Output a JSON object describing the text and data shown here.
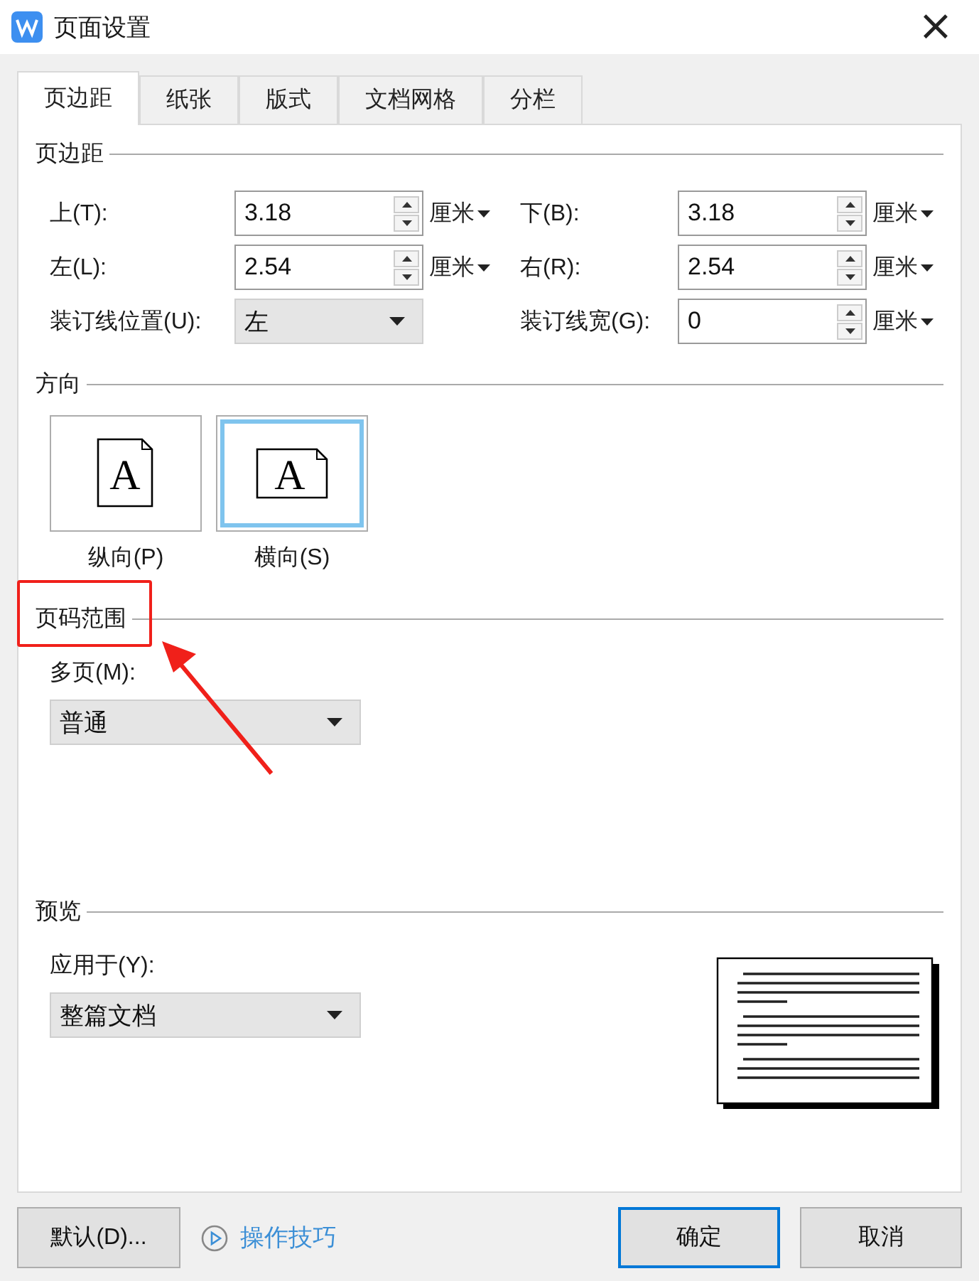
{
  "window": {
    "title": "页面设置",
    "close": "×"
  },
  "tabs": [
    {
      "label": "页边距",
      "selected": true
    },
    {
      "label": "纸张",
      "selected": false
    },
    {
      "label": "版式",
      "selected": false
    },
    {
      "label": "文档网格",
      "selected": false
    },
    {
      "label": "分栏",
      "selected": false
    }
  ],
  "margins": {
    "title": "页边距",
    "fields": [
      {
        "label": "上(T):",
        "kind": "spinner",
        "value": "3.18",
        "unit": "厘米"
      },
      {
        "label": "下(B):",
        "kind": "spinner",
        "value": "3.18",
        "unit": "厘米"
      },
      {
        "label": "左(L):",
        "kind": "spinner",
        "value": "2.54",
        "unit": "厘米"
      },
      {
        "label": "右(R):",
        "kind": "spinner",
        "value": "2.54",
        "unit": "厘米"
      },
      {
        "label": "装订线位置(U):",
        "kind": "select",
        "value": "左"
      },
      {
        "label": "装订线宽(G):",
        "kind": "spinner",
        "value": "0",
        "unit": "厘米"
      }
    ]
  },
  "orientation": {
    "title": "方向",
    "options": [
      {
        "label": "纵向(P)",
        "kind": "portrait",
        "glyph": "A",
        "selected": false
      },
      {
        "label": "横向(S)",
        "kind": "landscape",
        "glyph": "A",
        "selected": true
      }
    ]
  },
  "page_range": {
    "title": "页码范围",
    "label": "多页(M):",
    "value": "普通"
  },
  "preview": {
    "title": "预览",
    "label": "应用于(Y):",
    "value": "整篇文档"
  },
  "buttons": {
    "default": "默认(D)...",
    "tips": "操作技巧",
    "ok": "确定",
    "cancel": "取消"
  }
}
